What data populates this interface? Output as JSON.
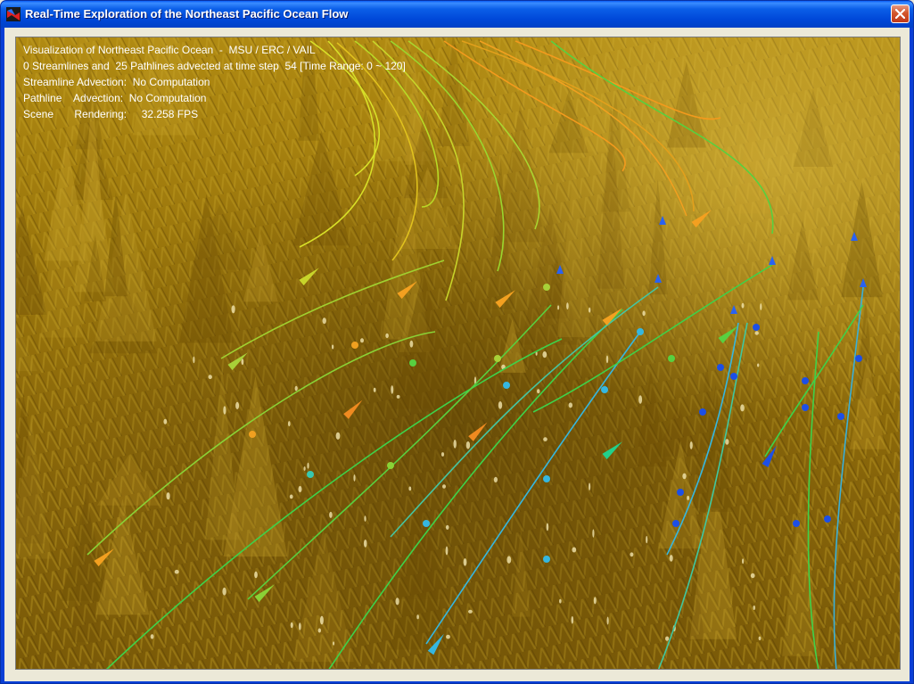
{
  "window": {
    "title": "Real-Time Exploration of the Northeast Pacific Ocean Flow"
  },
  "icons": {
    "app": "app-icon",
    "close": "close-icon"
  },
  "overlay": {
    "line1": "Visualization of Northeast Pacific Ocean  -  MSU / ERC / VAIL",
    "line2": "0 Streamlines and  25 Pathlines advected at time step  54 [Time Range: 0 ~ 120]",
    "line3": "Streamline Advection:  No Computation",
    "line4": "Pathline    Advection:  No Computation",
    "line5": "Scene       Rendering:     32.258 FPS"
  },
  "colors": {
    "terrain_dark": "#5a3f02",
    "terrain_mid": "#a47c0e",
    "terrain_light": "#d6b432",
    "titlebar": "#0054e3",
    "frame": "#ece9d8",
    "pathline_green": "#3ed24a",
    "pathline_cyan": "#35b7e0",
    "pathline_blue": "#1c4fe6",
    "pathline_orange": "#f39a1d",
    "pathline_yellow": "#d8e028"
  }
}
